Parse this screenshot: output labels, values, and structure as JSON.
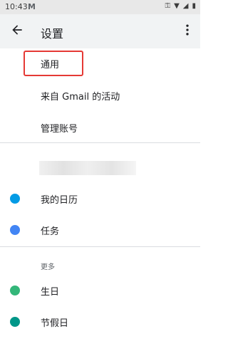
{
  "status_bar": {
    "time": "10:43",
    "app_icon": "M"
  },
  "app_bar": {
    "title": "设置"
  },
  "settings_items": [
    {
      "label": "通用"
    },
    {
      "label": "来自 Gmail 的活动"
    },
    {
      "label": "管理账号"
    }
  ],
  "calendars": [
    {
      "label": "我的日历",
      "color": "#039be5"
    },
    {
      "label": "任务",
      "color": "#4285f4"
    }
  ],
  "more_section": {
    "header": "更多",
    "items": [
      {
        "label": "生日",
        "color": "#33b679"
      },
      {
        "label": "节假日",
        "color": "#009688"
      }
    ]
  },
  "highlight_color": "#e53935"
}
